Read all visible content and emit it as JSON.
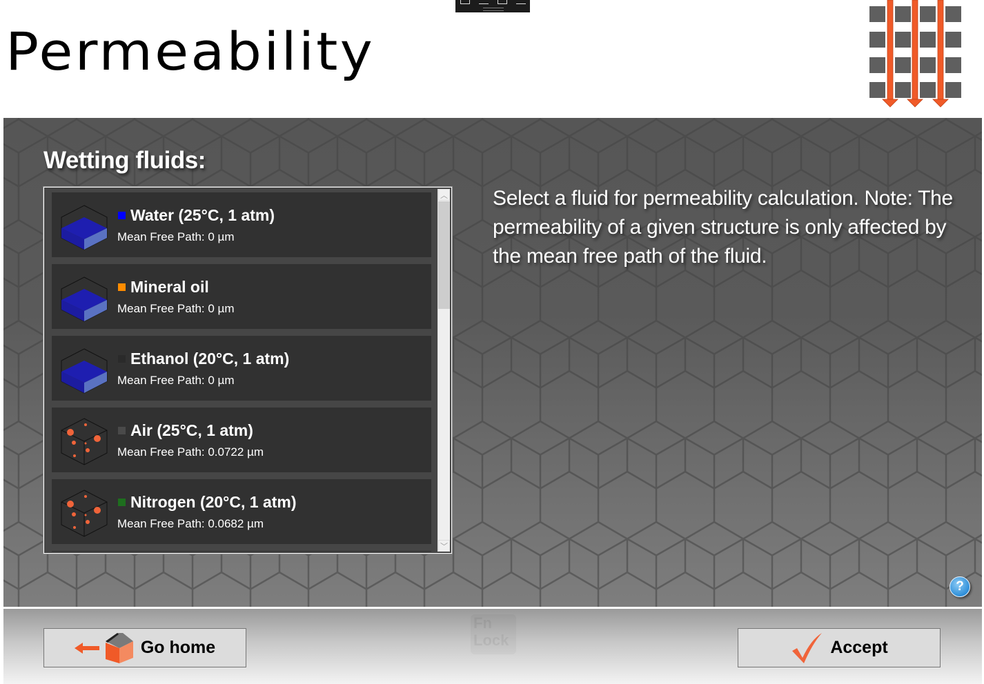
{
  "header": {
    "title": "Permeability",
    "logo_icon": "permeability-flow-icon"
  },
  "top_toolbar": {
    "icons": [
      "screen-snip-icon",
      "pen-icon",
      "window-icon",
      "pen-alt-icon"
    ]
  },
  "section": {
    "title": "Wetting fluids:"
  },
  "fluids": [
    {
      "name": "Water (25°C, 1 atm)",
      "mean_free_path": "Mean Free Path: 0 µm",
      "swatch_color": "#0000ff",
      "icon": "liquid-cube-icon"
    },
    {
      "name": "Mineral oil",
      "mean_free_path": "Mean Free Path: 0 µm",
      "swatch_color": "#ff8c00",
      "icon": "liquid-cube-icon"
    },
    {
      "name": "Ethanol (20°C, 1 atm)",
      "mean_free_path": "Mean Free Path: 0 µm",
      "swatch_color": "#2a2a2a",
      "icon": "liquid-cube-icon"
    },
    {
      "name": "Air (25°C, 1 atm)",
      "mean_free_path": "Mean Free Path: 0.0722 µm",
      "swatch_color": "#4a4a4a",
      "icon": "gas-cube-icon"
    },
    {
      "name": "Nitrogen (20°C, 1 atm)",
      "mean_free_path": "Mean Free Path: 0.0682 µm",
      "swatch_color": "#1e6e1e",
      "icon": "gas-cube-icon"
    }
  ],
  "description": "Select a fluid for permeability calculation. Note: The permeability of a given structure is only affected by the mean free path of the fluid.",
  "help": {
    "label": "?"
  },
  "footer": {
    "go_home_label": "Go home",
    "accept_label": "Accept",
    "fn_lock_line1": "Fn",
    "fn_lock_line2": "Lock"
  },
  "colors": {
    "accent": "#f05a28",
    "panel": "#5a5a5a",
    "item_bg": "#313131"
  }
}
